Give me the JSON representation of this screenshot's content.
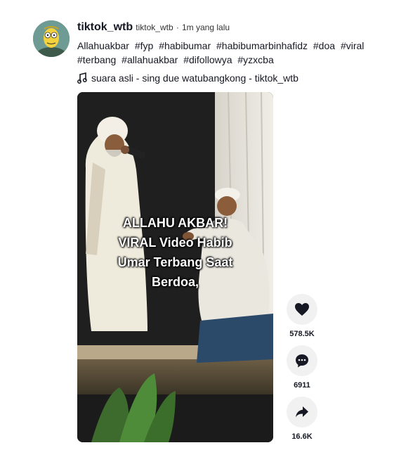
{
  "author": {
    "display_name": "tiktok_wtb",
    "handle": "tiktok_wtb",
    "separator": "·",
    "time_ago": "1m yang lalu"
  },
  "caption": {
    "text": "Allahuakbar",
    "hashtags": [
      "#fyp",
      "#habibumar",
      "#habibumarbinhafidz",
      "#doa",
      "#viral",
      "#terbang",
      "#allahuakbar",
      "#difollowya",
      "#yzxcba"
    ]
  },
  "music": {
    "icon": "music-note-icon",
    "title": "suara asli - sing due watubangkong - tiktok_wtb"
  },
  "video": {
    "overlay_lines": [
      "ALLAHU AKBAR!",
      "VIRAL Video Habib",
      "Umar Terbang Saat",
      "Berdoa,"
    ]
  },
  "actions": {
    "like": {
      "icon": "heart-icon",
      "count": "578.5K"
    },
    "comment": {
      "icon": "comment-icon",
      "count": "6911"
    },
    "share": {
      "icon": "share-icon",
      "count": "16.6K"
    }
  },
  "colors": {
    "text": "#161823",
    "action_bg": "#f1f1f2",
    "overlay_text": "#ffffff"
  }
}
